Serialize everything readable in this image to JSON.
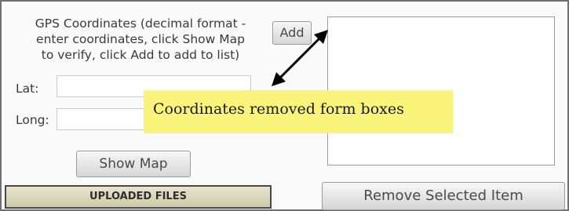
{
  "gps_panel": {
    "help_text": "GPS Coordinates (decimal format -\nenter coordinates, click Show Map\nto verify, click Add to add to list)",
    "lat_label": "Lat:",
    "lat_value": "",
    "long_label": "Long:",
    "long_value": "",
    "show_map_label": "Show Map",
    "add_label": "Add"
  },
  "coordinates_list": {
    "items": [],
    "remove_label": "Remove Selected Item"
  },
  "uploaded_files": {
    "header": "UPLOADED FILES"
  },
  "annotation": {
    "text": "Coordinates removed form boxes",
    "background": "#fbf47a"
  }
}
